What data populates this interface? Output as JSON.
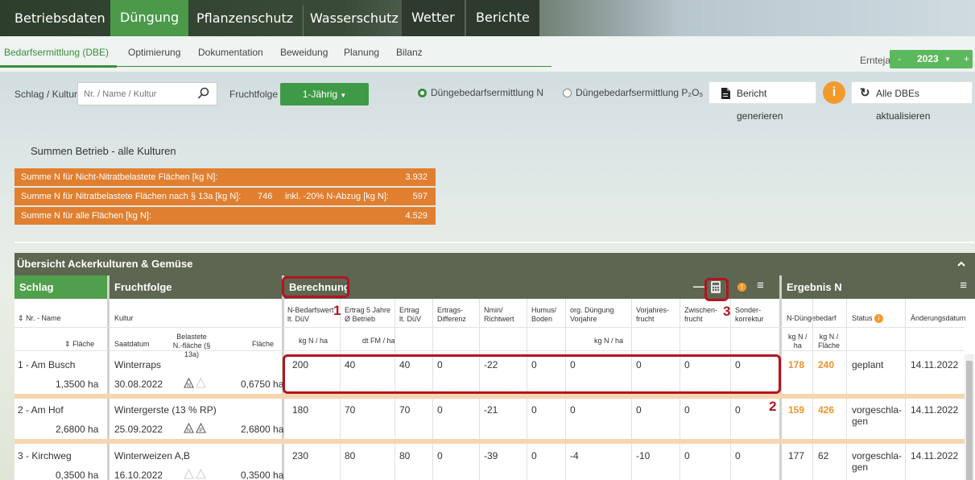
{
  "topnav": [
    "Betriebsdaten",
    "Düngung",
    "Pflanzenschutz",
    "Wasserschutz",
    "Wetter",
    "Berichte"
  ],
  "subnav": [
    "Bedarfsermittlung (DBE)",
    "Optimierung",
    "Dokumentation",
    "Beweidung",
    "Planung",
    "Bilanz"
  ],
  "erntejahr": {
    "label": "Erntejahr",
    "minus": "-",
    "value": "2023",
    "plus": "+"
  },
  "filter": {
    "schlag_label": "Schlag / Kultur",
    "search_placeholder": "Nr. / Name / Kultur",
    "fruchtfolge_label": "Fruchtfolge",
    "fruchtfolge_value": "1-Jährig",
    "radio_n": "Düngebedarfsermittlung N",
    "radio_p": "Düngebedarfsermittlung P₂O₅",
    "bericht_button": "Bericht generieren",
    "aktualisieren_button": "Alle DBEs aktualisieren"
  },
  "summen": {
    "title": "Summen Betrieb - alle Kulturen",
    "rows": [
      {
        "label": "Summe N für Nicht-Nitratbelastete Flächen [kg N]:",
        "value": "3.932"
      },
      {
        "label": "Summe N für Nitratbelastete Flächen nach § 13a [kg N]:",
        "mid_value": "746",
        "mid_label": "inkl. -20% N-Abzug [kg N]:",
        "value": "597"
      },
      {
        "label": "Summe N für alle Flächen [kg N]:",
        "value": "4.529"
      }
    ]
  },
  "overview": {
    "title": "Übersicht Ackerkulturen & Gemüse",
    "groups": {
      "schlag": "Schlag",
      "fruchtfolge": "Fruchtfolge",
      "berechnung": "Berechnung",
      "ergebnis": "Ergebnis N"
    },
    "headers": {
      "nr_name": "Nr. - Name",
      "flaeche": "Fläche",
      "kultur": "Kultur",
      "saatdatum": "Saatdatum",
      "belastete": "Belastete",
      "belastete2": "N.-fläche (§ 13a)",
      "flaeche2": "Fläche",
      "nbed1": "N-Bedarfswert",
      "nbed2": "lt. DüV",
      "ertrag5a": "Ertrag 5 Jahre",
      "ertrag5b": "Ø Betrieb",
      "ertrag_a": "Ertrag",
      "ertrag_b": "lt. DüV",
      "ediff_a": "Ertrags-",
      "ediff_b": "Differenz",
      "nmin_a": "Nmin/",
      "nmin_b": "Richtwert",
      "humus_a": "Humus/",
      "humus_b": "Boden",
      "org_a": "org. Düngung",
      "org_b": "Vorjahre",
      "vor_a": "Vorjahres-",
      "vor_b": "frucht",
      "zw_a": "Zwischen-",
      "zw_b": "frucht",
      "so_a": "Sonder-",
      "so_b": "korrektur",
      "unit_kgnha": "kg N / ha",
      "unit_dtfm": "dt FM / ha",
      "unit_kgnha2": "kg N / ha",
      "ndb": "N-Düngebedarf",
      "status": "Status",
      "aenderung": "Änderungsdatum",
      "kgn_a": "kg N /",
      "kgn_b": "ha",
      "kgf_a": "kg N /",
      "kgf_b": "Fläche"
    },
    "rows": [
      {
        "name": "1 - Am Busch",
        "flaeche": "1,3500 ha",
        "kultur": "Winterraps",
        "saat": "30.08.2022",
        "bel_flaeche": "0,6750 ha",
        "v": [
          "200",
          "40",
          "40",
          "0",
          "-22",
          "0",
          "0",
          "0",
          "0",
          "0"
        ],
        "kgha": "178",
        "kgfl": "240",
        "status": "geplant",
        "datum": "14.11.2022"
      },
      {
        "name": "2 - Am Hof",
        "flaeche": "2,6800 ha",
        "kultur": "Wintergerste (13 % RP)",
        "saat": "25.09.2022",
        "bel_flaeche": "2,6800 ha",
        "v": [
          "180",
          "70",
          "70",
          "0",
          "-21",
          "0",
          "0",
          "0",
          "0",
          "0"
        ],
        "kgha": "159",
        "kgfl": "426",
        "status_a": "vorgeschla-",
        "status_b": "gen",
        "datum": "14.11.2022"
      },
      {
        "name": "3 - Kirchweg",
        "flaeche": "0,3500 ha",
        "kultur": "Winterweizen A,B",
        "saat": "16.10.2022",
        "bel_flaeche": "0,3500 ha",
        "v": [
          "230",
          "80",
          "80",
          "0",
          "-39",
          "0",
          "-4",
          "-10",
          "0",
          "0"
        ],
        "kgha": "177",
        "kgfl": "62",
        "status_a": "vorgeschla-",
        "status_b": "gen",
        "datum": "14.11.2022"
      }
    ],
    "annotations": [
      "1",
      "2",
      "3"
    ]
  }
}
